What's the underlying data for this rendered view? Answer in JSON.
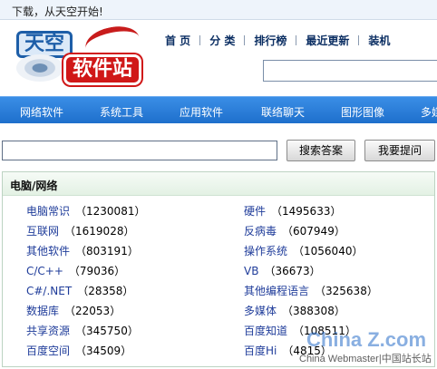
{
  "topbar": {
    "text": "下载，从天空开始!"
  },
  "logo": {
    "part1": "天空",
    "part2": "软件站"
  },
  "nav": [
    {
      "label": "首 页"
    },
    {
      "label": "分 类"
    },
    {
      "label": "排行榜"
    },
    {
      "label": "最近更新"
    },
    {
      "label": "装机"
    }
  ],
  "categories_bar": [
    {
      "label": "网络软件"
    },
    {
      "label": "系统工具"
    },
    {
      "label": "应用软件"
    },
    {
      "label": "联络聊天"
    },
    {
      "label": "图形图像"
    },
    {
      "label": "多媒"
    }
  ],
  "search": {
    "value": "",
    "search_button": "搜索答案",
    "ask_button": "我要提问"
  },
  "panel": {
    "title": "电脑/网络",
    "items": [
      {
        "name": "电脑常识",
        "count": "（1230081）"
      },
      {
        "name": "硬件",
        "count": "（1495633）"
      },
      {
        "name": "互联网",
        "count": "（1619028）"
      },
      {
        "name": "反病毒",
        "count": "（607949）"
      },
      {
        "name": "其他软件",
        "count": "（803191）"
      },
      {
        "name": "操作系统",
        "count": "（1056040）"
      },
      {
        "name": "C/C++",
        "count": "（79036）"
      },
      {
        "name": "VB",
        "count": "（36673）"
      },
      {
        "name": "C#/.NET",
        "count": "（28358）"
      },
      {
        "name": "其他编程语言",
        "count": "（325638）"
      },
      {
        "name": "数据库",
        "count": "（22053）"
      },
      {
        "name": "多媒体",
        "count": "（388308）"
      },
      {
        "name": "共享资源",
        "count": "（345750）"
      },
      {
        "name": "百度知道",
        "count": "（108511）"
      },
      {
        "name": "百度空间",
        "count": "（34509）"
      },
      {
        "name": "百度Hi",
        "count": "（4815）"
      }
    ]
  },
  "watermark": {
    "brand": "China Z.com",
    "caption": "China Webmaster|中国站长站"
  },
  "colors": {
    "nav_blue": "#1e6fcc",
    "link_blue": "#1f3c9a",
    "panel_green": "#e3f1e4",
    "logo_red": "#d01818"
  }
}
